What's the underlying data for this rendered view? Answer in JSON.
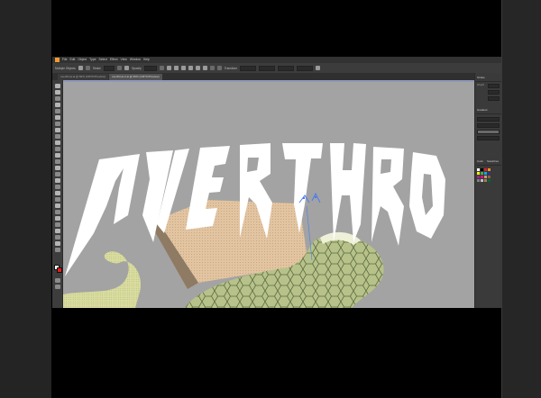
{
  "menu": {
    "items": [
      "File",
      "Edit",
      "Object",
      "Type",
      "Select",
      "Effect",
      "View",
      "Window",
      "Help"
    ]
  },
  "control_bar": {
    "selection_label": "Multiple Objects",
    "stroke_label": "Stroke",
    "style_label": "Style",
    "opacity_label": "Opacity",
    "transform_label": "Transform"
  },
  "document_tabs": [
    {
      "label": "overthrow.ai @ 66% (CMYK/Preview)",
      "active": false
    },
    {
      "label": "overthrow-2.ai @ 66% (CMYK/Preview)",
      "active": true
    }
  ],
  "panels": {
    "stroke_title": "Stroke",
    "weight_label": "Weight",
    "gradient_title": "Gradient",
    "color_title": "Color",
    "swatches_title": "Swatches",
    "swatch_colors": [
      "#ffffff",
      "#000000",
      "#e31c1c",
      "#f7931e",
      "#fff200",
      "#39b54a",
      "#00aeef",
      "#2e3192",
      "#92278f",
      "#ec008c",
      "#c69c6d",
      "#8c6239",
      "#808080",
      "#c0c0c0",
      "#a67c52",
      "#006837"
    ]
  },
  "artwork": {
    "headline": "OVERTHRO",
    "letter_color": "#ffffff",
    "skin_color": "#e3c4a1",
    "snake_color": "#b7c28a",
    "scale_line_color": "#5c6a3f"
  },
  "colors": {
    "canvas_bg": "#a3a3a3",
    "ui_dark": "#3c3c3c",
    "accent_selection": "#4a7cf0"
  }
}
